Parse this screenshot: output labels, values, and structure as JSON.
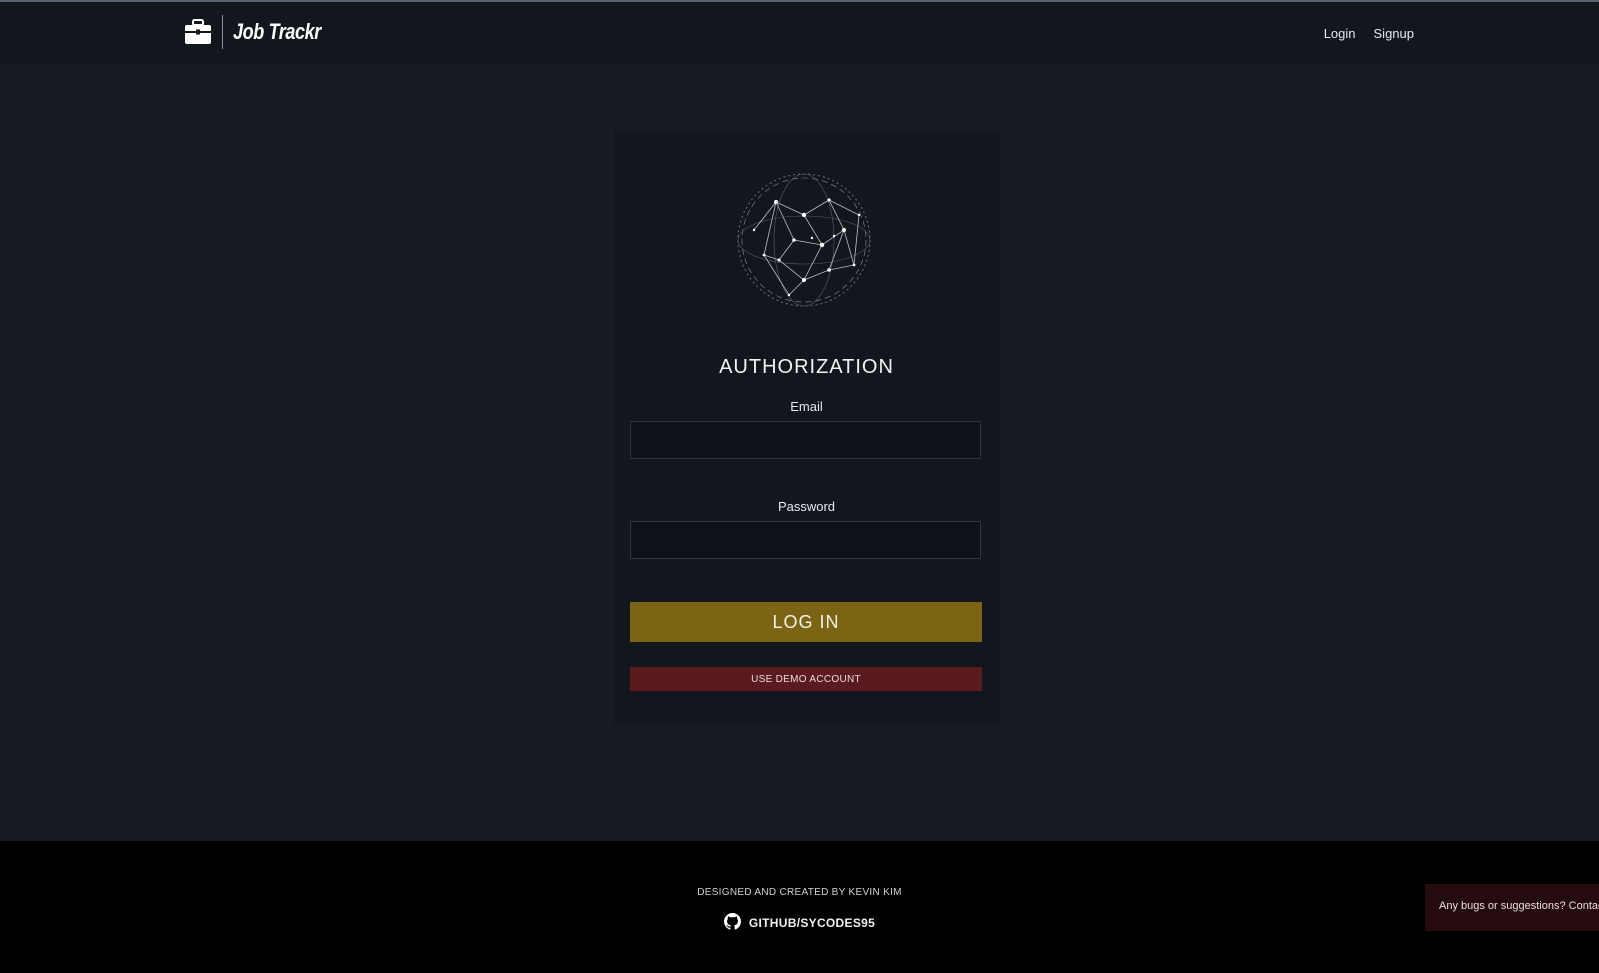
{
  "navbar": {
    "brand_title": "Job Trackr",
    "brand_icon": "briefcase-icon",
    "links": {
      "login": "Login",
      "signup": "Signup"
    }
  },
  "auth_form": {
    "logo_icon": "network-globe-icon",
    "title": "AUTHORIZATION",
    "email_label": "Email",
    "email_value": "",
    "password_label": "Password",
    "password_value": "",
    "login_button": "LOG IN",
    "demo_button": "USE DEMO ACCOUNT"
  },
  "footer": {
    "credit": "DESIGNED AND CREATED BY KEVIN KIM",
    "github_icon": "github-icon",
    "github_link": "GITHUB/SYCODES95"
  },
  "feedback": {
    "text": "Any bugs or suggestions? Contac"
  },
  "colors": {
    "page_background": "#161a23",
    "navbar_background": "#12161d",
    "login_button": "#7c6415",
    "demo_button": "#5a1a20",
    "footer_background": "#000000",
    "feedback_background": "#260b0e"
  }
}
